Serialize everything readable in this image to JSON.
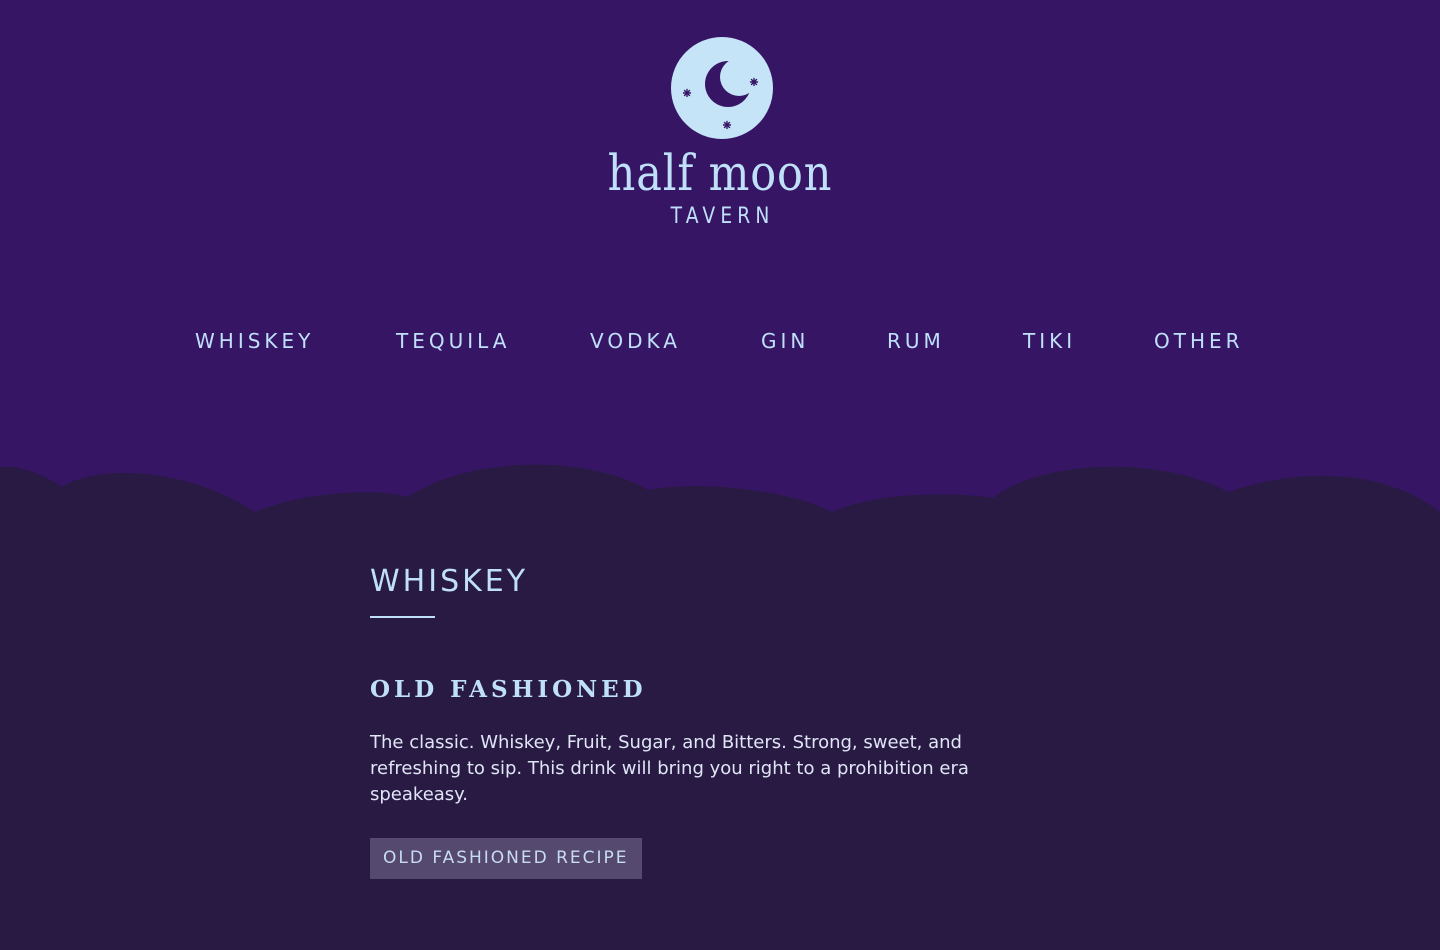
{
  "colors": {
    "header_bg": "#361565",
    "body_bg": "#291a43",
    "accent": "#bfe0f8",
    "button_bg": "#55496f"
  },
  "brand": {
    "name": "half moon",
    "subtitle": "TAVERN",
    "logo_icon": "moon-icon"
  },
  "nav": {
    "items": [
      "WHISKEY",
      "TEQUILA",
      "VODKA",
      "GIN",
      "RUM",
      "TIKI",
      "OTHER"
    ]
  },
  "section": {
    "title": "WHISKEY"
  },
  "drink": {
    "name": "OLD FASHIONED",
    "description": "The classic. Whiskey, Fruit, Sugar, and Bitters. Strong, sweet, and refreshing to sip. This drink will bring you right to a prohibition era speakeasy.",
    "button_label": "OLD FASHIONED RECIPE"
  }
}
